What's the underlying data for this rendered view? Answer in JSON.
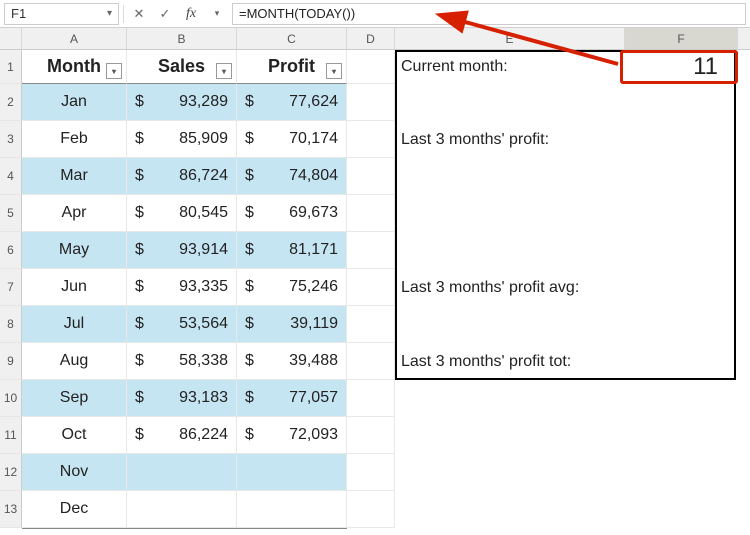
{
  "formula_bar": {
    "name_box": "F1",
    "formula": "=MONTH(TODAY())"
  },
  "columns": [
    "A",
    "B",
    "C",
    "D",
    "E",
    "F"
  ],
  "headers": {
    "month": "Month",
    "sales": "Sales",
    "profit": "Profit"
  },
  "labels": {
    "current_month": "Current month:",
    "last3_profit": "Last 3 months' profit:",
    "last3_avg": "Last 3 months' profit avg:",
    "last3_tot": "Last 3 months' profit tot:"
  },
  "values": {
    "current_month": "11"
  },
  "data": [
    {
      "month": "Jan",
      "sales": "93,289",
      "profit": "77,624",
      "band": true
    },
    {
      "month": "Feb",
      "sales": "85,909",
      "profit": "70,174",
      "band": false
    },
    {
      "month": "Mar",
      "sales": "86,724",
      "profit": "74,804",
      "band": true
    },
    {
      "month": "Apr",
      "sales": "80,545",
      "profit": "69,673",
      "band": false
    },
    {
      "month": "May",
      "sales": "93,914",
      "profit": "81,171",
      "band": true
    },
    {
      "month": "Jun",
      "sales": "93,335",
      "profit": "75,246",
      "band": false
    },
    {
      "month": "Jul",
      "sales": "53,564",
      "profit": "39,119",
      "band": true
    },
    {
      "month": "Aug",
      "sales": "58,338",
      "profit": "39,488",
      "band": false
    },
    {
      "month": "Sep",
      "sales": "93,183",
      "profit": "77,057",
      "band": true
    },
    {
      "month": "Oct",
      "sales": "86,224",
      "profit": "72,093",
      "band": false
    },
    {
      "month": "Nov",
      "sales": "",
      "profit": "",
      "band": true
    },
    {
      "month": "Dec",
      "sales": "",
      "profit": "",
      "band": false
    }
  ]
}
